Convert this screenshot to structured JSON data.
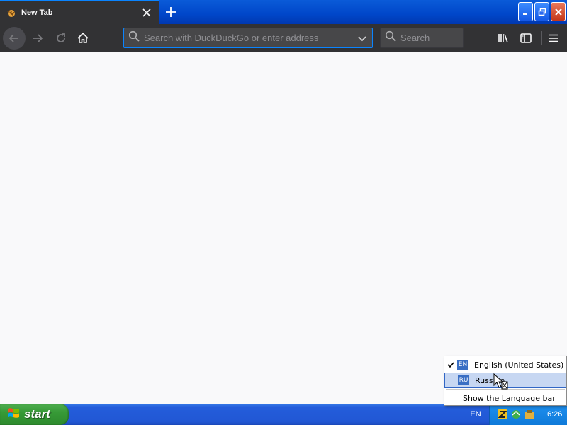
{
  "browser": {
    "tab": {
      "title": "New Tab"
    },
    "urlbar": {
      "placeholder": "Search with DuckDuckGo or enter address"
    },
    "searchbar": {
      "placeholder": "Search"
    },
    "accent_color": "#0a84ff",
    "toolbar_color": "#323234"
  },
  "language_menu": {
    "items": [
      {
        "code": "EN",
        "label": "English (United States)",
        "checked": true
      },
      {
        "code": "RU",
        "label": "Russian",
        "checked": false
      }
    ],
    "show_bar_label": "Show the Language bar"
  },
  "taskbar": {
    "start_label": "start",
    "language_indicator": "EN",
    "clock": "6:26"
  }
}
